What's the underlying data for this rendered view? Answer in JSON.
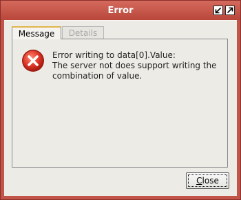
{
  "window": {
    "title": "Error",
    "title_buttons": [
      {
        "name": "minimize-icon"
      },
      {
        "name": "maximize-icon"
      }
    ]
  },
  "tabs": [
    {
      "label": "Message",
      "active": true
    },
    {
      "label": "Details",
      "active": false
    }
  ],
  "message": {
    "icon": "error-icon",
    "lines": [
      "Error writing to data[0].Value:",
      "The server not does support writing the",
      "combination of value."
    ]
  },
  "buttons": {
    "close_mnemonic": "C",
    "close_rest": "lose"
  },
  "colors": {
    "titlebar": "#c1554a",
    "error_red": "#e03a2a",
    "active_tab_accent": "#e2b44a"
  }
}
